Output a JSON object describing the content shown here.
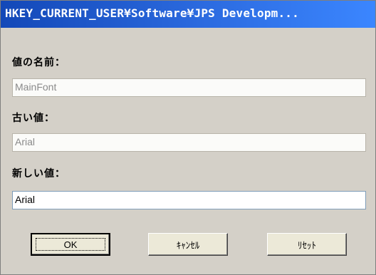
{
  "window": {
    "title": "HKEY_CURRENT_USER¥Software¥JPS Developm..."
  },
  "form": {
    "value_name_label": "値の名前：",
    "value_name": "MainFont",
    "old_value_label": "古い値：",
    "old_value": "Arial",
    "new_value_label": "新しい値：",
    "new_value": "Arial"
  },
  "buttons": {
    "ok": "OK",
    "cancel": "ｷｬﾝｾﾙ",
    "reset": "ﾘｾｯﾄ"
  }
}
